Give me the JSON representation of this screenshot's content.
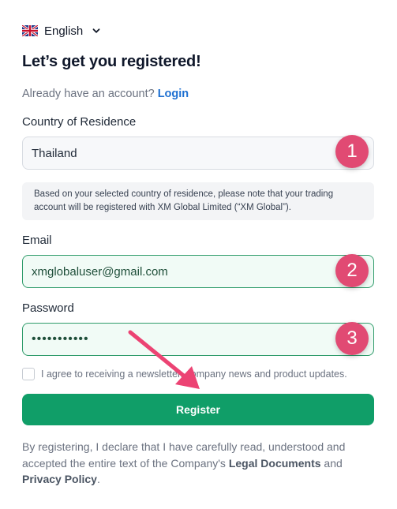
{
  "language": {
    "label": "English",
    "flag_icon": "uk-flag-icon",
    "dropdown_icon": "chevron-down-icon"
  },
  "heading": "Let’s get you registered!",
  "login_prompt": {
    "text": "Already have an account?",
    "link": "Login"
  },
  "country": {
    "label": "Country of Residence",
    "value": "Thailand"
  },
  "notice": "Based on your selected country of residence, please note that your trading account will be registered with XM Global Limited (“XM Global”).",
  "email": {
    "label": "Email",
    "value": "xmglobaluser@gmail.com"
  },
  "password": {
    "label": "Password",
    "value": "•••••••••••"
  },
  "newsletter": {
    "label": "I agree to receiving a newsletter, company news and product updates.",
    "checked": false
  },
  "register_button": "Register",
  "disclaimer": {
    "text": "By registering, I declare that I have carefully read, understood and accepted the entire text of the Company's",
    "legal_link": "Legal Documents",
    "and": "and",
    "privacy_link": "Privacy Policy",
    "end": "."
  },
  "annotations": {
    "step1": "1",
    "step2": "2",
    "step3": "3",
    "badge_color": "#e14a73"
  },
  "colors": {
    "primary": "#109e68",
    "link": "#1d6fd1"
  }
}
